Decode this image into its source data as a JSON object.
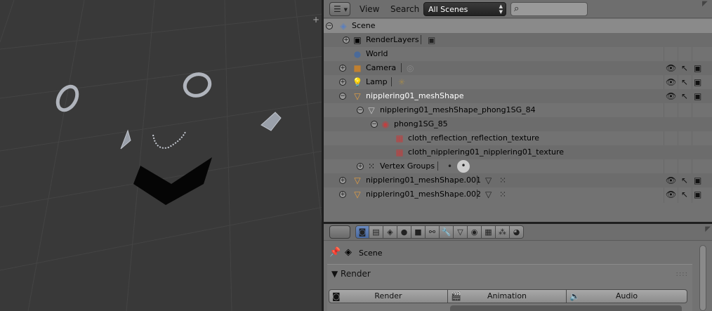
{
  "outliner": {
    "header": {
      "menu_view": "View",
      "menu_search": "Search",
      "scenes_select": "All Scenes",
      "search_value": ""
    },
    "rows": [
      {
        "label": "Scene",
        "icon": "scene-icon"
      },
      {
        "label": "RenderLayers",
        "icon": "render-layers-icon"
      },
      {
        "label": "World",
        "icon": "world-icon"
      },
      {
        "label": "Camera",
        "icon": "camera-icon"
      },
      {
        "label": "Lamp",
        "icon": "lamp-icon"
      },
      {
        "label": "nipplering01_meshShape",
        "icon": "mesh-icon"
      },
      {
        "label": "nipplering01_meshShape_phong1SG_84",
        "icon": "mesh-data-icon"
      },
      {
        "label": "phong1SG_85",
        "icon": "material-icon"
      },
      {
        "label": "cloth_reflection_reflection_texture",
        "icon": "texture-icon"
      },
      {
        "label": "cloth_nipplering01_nipplering01_texture",
        "icon": "texture-icon"
      },
      {
        "label": "Vertex Groups",
        "icon": "vertex-groups-icon"
      },
      {
        "label": "nipplering01_meshShape.001",
        "icon": "mesh-icon"
      },
      {
        "label": "nipplering01_meshShape.002",
        "icon": "mesh-icon"
      }
    ]
  },
  "properties": {
    "context_label": "Scene",
    "panel_title": "Render",
    "buttons": {
      "render": "Render",
      "animation": "Animation",
      "audio": "Audio"
    },
    "tabs": [
      "render-tab-icon",
      "render-layers-tab-icon",
      "scene-tab-icon",
      "world-tab-icon",
      "object-tab-icon",
      "constraints-tab-icon",
      "modifiers-tab-icon",
      "data-tab-icon",
      "material-tab-icon",
      "texture-tab-icon",
      "particles-tab-icon",
      "physics-tab-icon"
    ]
  },
  "colors": {
    "viewport_bg": "#393939",
    "outliner_bg": "#727272",
    "selected_label": "#ffffff",
    "mesh_orange": "#e8a040"
  }
}
